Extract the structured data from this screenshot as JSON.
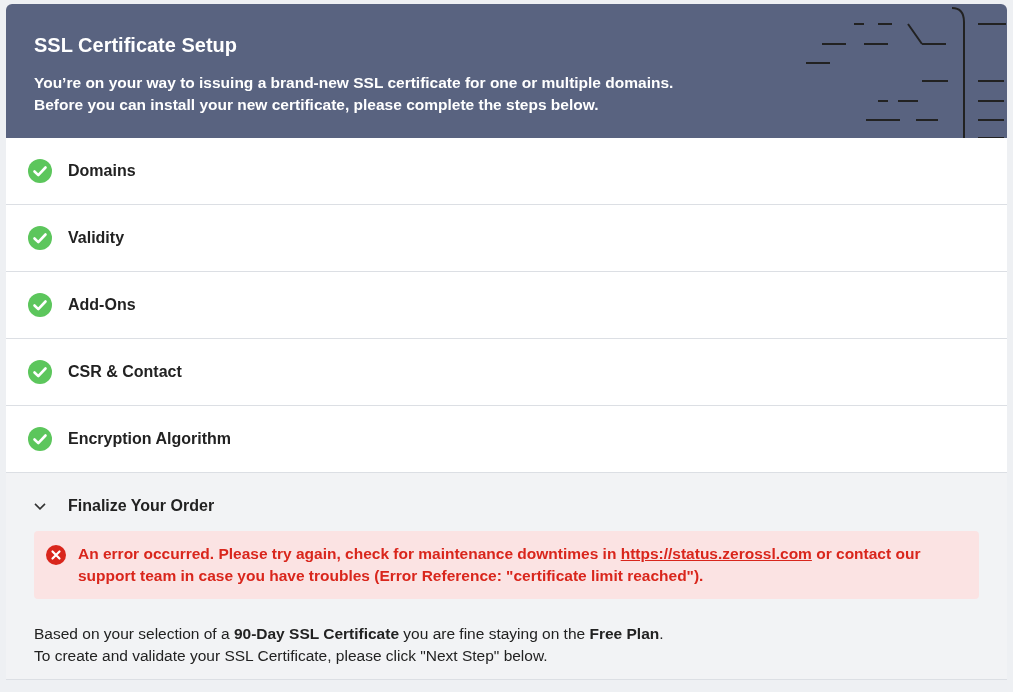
{
  "header": {
    "title": "SSL Certificate Setup",
    "lines": [
      "You’re on your way to issuing a brand-new SSL certificate for one or multiple domains.",
      "Before you can install your new certificate, please complete the steps below."
    ]
  },
  "steps": [
    {
      "label": "Domains",
      "done": true,
      "expanded": false
    },
    {
      "label": "Validity",
      "done": true,
      "expanded": false
    },
    {
      "label": "Add-Ons",
      "done": true,
      "expanded": false
    },
    {
      "label": "CSR & Contact",
      "done": true,
      "expanded": false
    },
    {
      "label": "Encryption Algorithm",
      "done": true,
      "expanded": false
    },
    {
      "label": "Finalize Your Order",
      "done": false,
      "expanded": true
    }
  ],
  "error": {
    "before": "An error occurred. Please try again, check for maintenance downtimes in ",
    "link": "https://status.zerossl.com",
    "after": " or contact our support team in case you have troubles (Error Reference: \"certificate limit reached\")."
  },
  "info": [
    "Based on your selection of a **90-Day SSL Certificate** you are fine staying on the **Free Plan**.",
    "To create and validate your SSL Certificate, please click \"Next Step\" below."
  ]
}
